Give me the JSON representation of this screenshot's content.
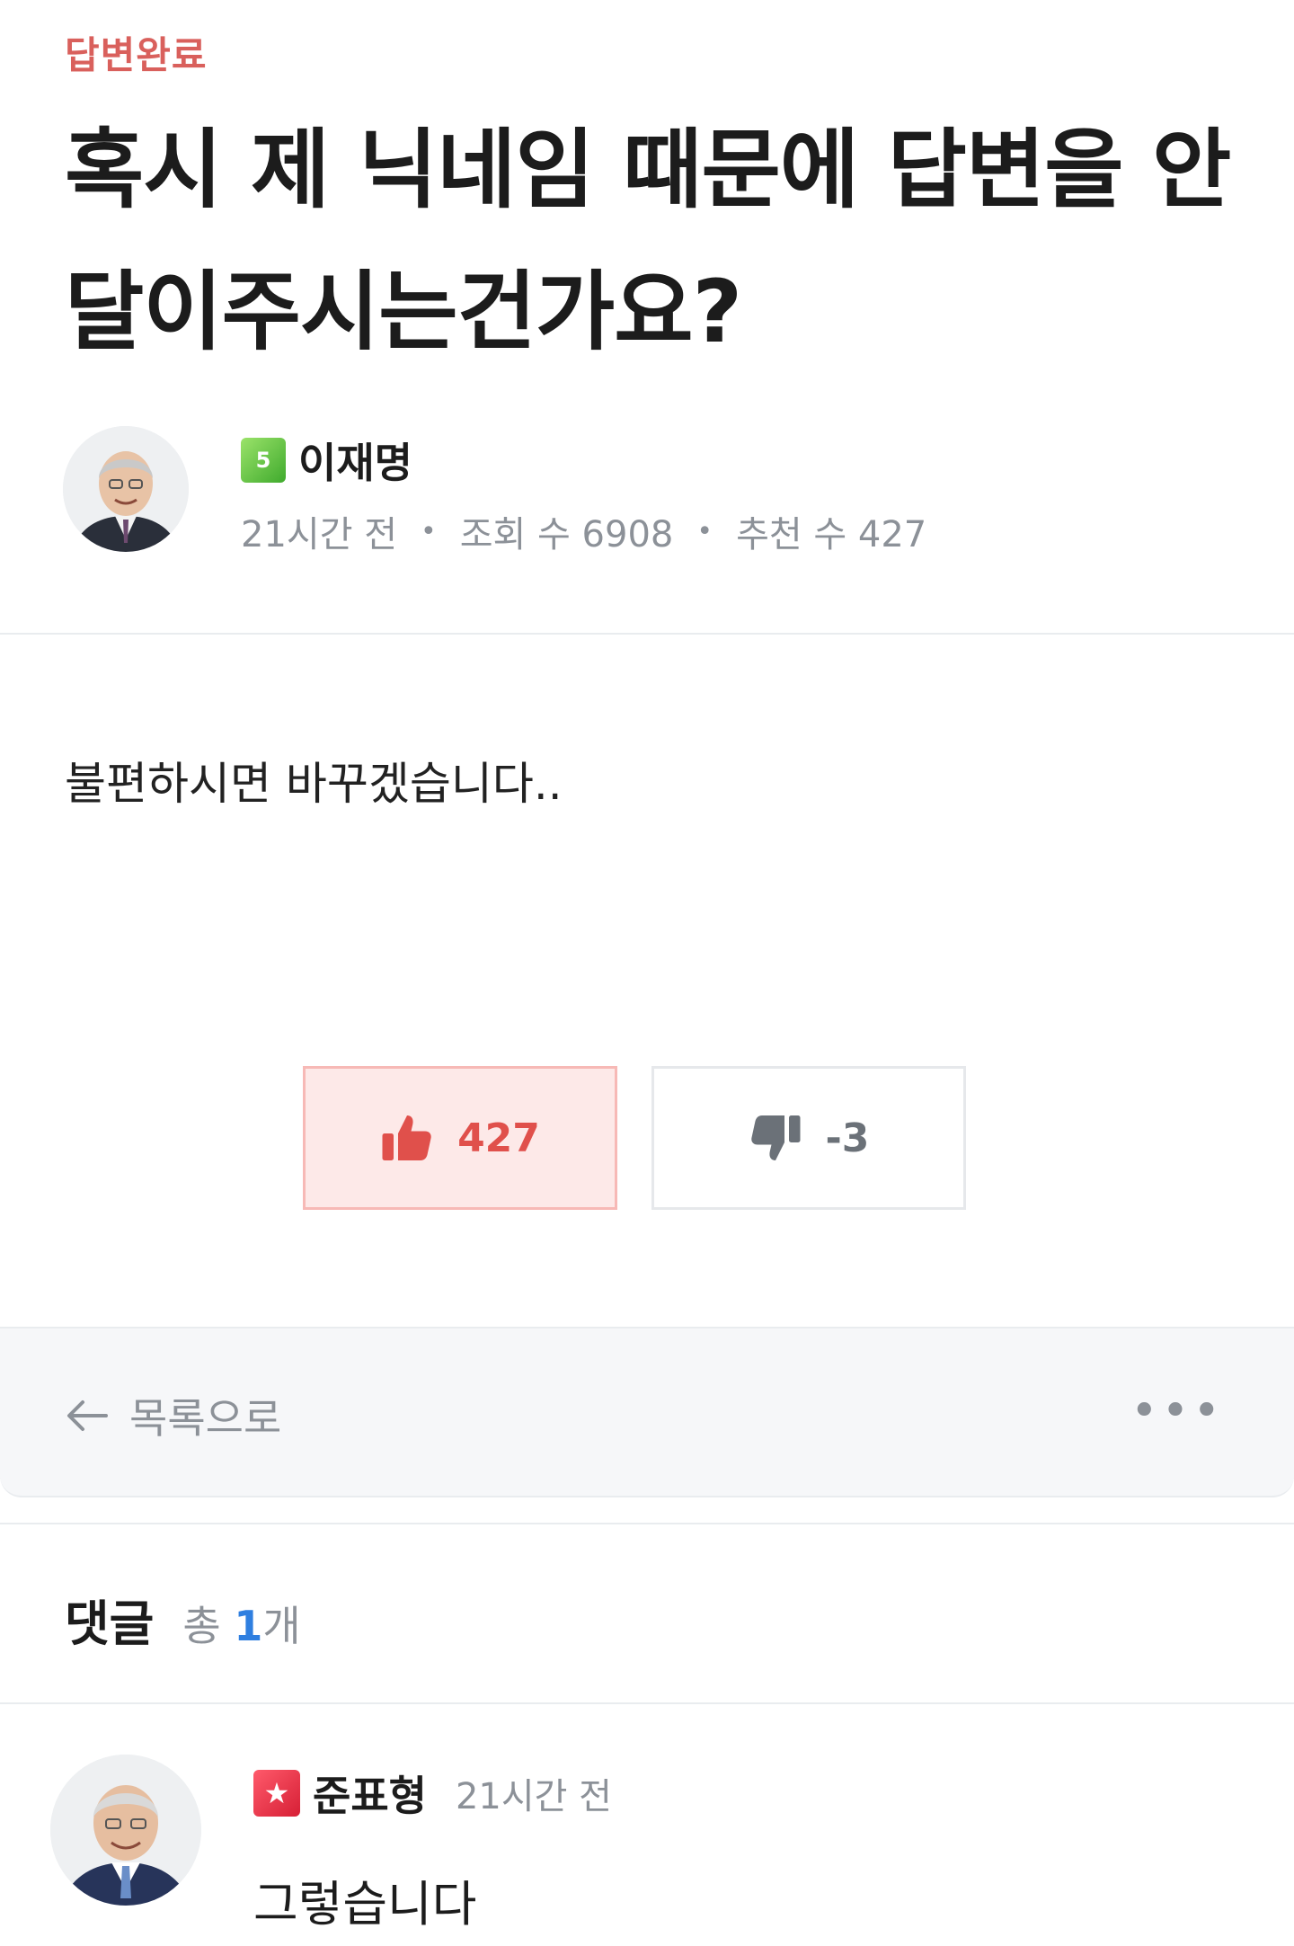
{
  "post": {
    "status": "답변완료",
    "title": "혹시 제 닉네임 때문에 답변을 안달이주시는건가요?",
    "author": {
      "level": "5",
      "name": "이재명",
      "time": "21시간 전",
      "views": "조회 수 6908",
      "recommends": "추천 수 427"
    },
    "body": "불편하시면 바꾸겠습니다.."
  },
  "votes": {
    "up": "427",
    "down": "-3",
    "up_icon": "thumbs-up-icon",
    "down_icon": "thumbs-down-icon"
  },
  "nav": {
    "back_label": "목록으로",
    "more_label": "•••"
  },
  "comments": {
    "title": "댓글",
    "total_prefix": "총",
    "count": "1",
    "unit": "개",
    "items": [
      {
        "name": "준표형",
        "time": "21시간 전",
        "text": "그렇습니다",
        "badge": "★"
      }
    ]
  },
  "colors": {
    "status": "#d9605c",
    "vote_up": "#e0504b",
    "vote_up_bg": "#fde9e8",
    "count_accent": "#2f7fe0",
    "muted": "#8c9198"
  }
}
